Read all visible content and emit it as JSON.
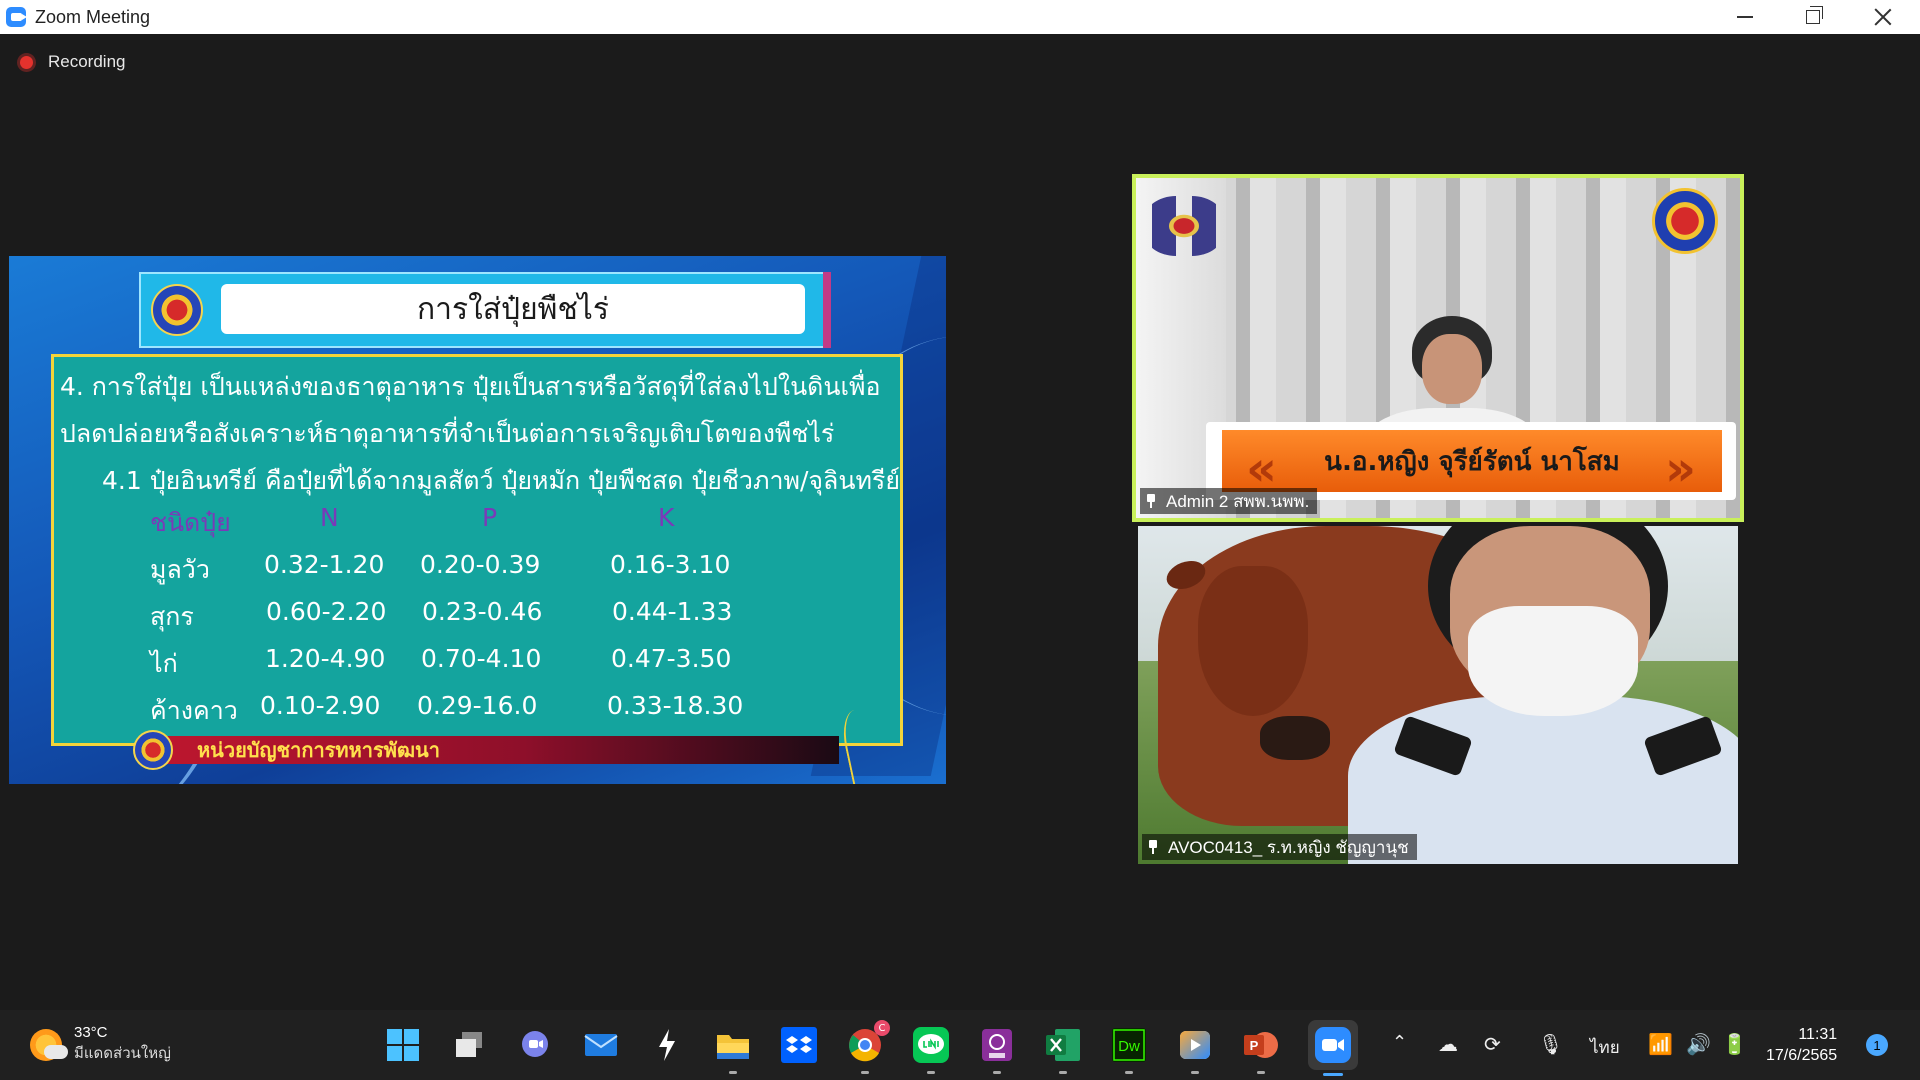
{
  "window": {
    "title": "Zoom Meeting"
  },
  "recording": {
    "label": "Recording"
  },
  "slide": {
    "title": "การใส่ปุ๋ยพืชไร่",
    "paragraph_1": "4. การใส่ปุ๋ย  เป็นแหล่งของธาตุอาหาร ปุ๋ยเป็นสารหรือวัสดุที่ใส่ลงไปในดินเพื่อ",
    "paragraph_2": "ปลดปล่อยหรือสังเคราะห์ธาตุอาหารที่จำเป็นต่อการเจริญเติบโตของพืชไร่",
    "paragraph_3": "4.1 ปุ๋ยอินทรีย์ คือปุ๋ยที่ได้จากมูลสัตว์ ปุ๋ยหมัก ปุ๋ยพืชสด ปุ๋ยชีวภาพ/จุลินทรีย์",
    "table": {
      "headers": [
        "ชนิดปุ๋ย",
        "N",
        "P",
        "K"
      ],
      "rows": [
        [
          "มูลวัว",
          "0.32-1.20",
          "0.20-0.39",
          "0.16-3.10"
        ],
        [
          "สุกร",
          "0.60-2.20",
          "0.23-0.46",
          "0.44-1.33"
        ],
        [
          "ไก่",
          "1.20-4.90",
          "0.70-4.10",
          "0.47-3.50"
        ],
        [
          "ค้างคาว",
          "0.10-2.90",
          "0.29-16.0",
          "0.33-18.30"
        ]
      ]
    },
    "footer": "หน่วยบัญชาการทหารพัฒนา"
  },
  "participants": [
    {
      "name": "Admin 2 สพพ.นพพ.",
      "banner": "น.อ.หญิง จุรีย์รัตน์  นาโสม",
      "active_speaker": true
    },
    {
      "name": "AVOC0413_ ร.ท.หญิง ชัญญานุช",
      "active_speaker": false
    }
  ],
  "taskbar": {
    "weather_temp": "33°C",
    "weather_desc": "มีแดดส่วนใหญ่",
    "language": "ไทย",
    "time": "11:31",
    "date": "17/6/2565",
    "notification_count": "1",
    "chrome_badge": "C",
    "apps": [
      "windows-start",
      "task-view",
      "teams-chat",
      "mail",
      "unknown-app",
      "file-explorer",
      "dropbox",
      "chrome",
      "line",
      "pdf-app",
      "excel",
      "dreamweaver",
      "media-player",
      "powerpoint",
      "zoom"
    ]
  }
}
